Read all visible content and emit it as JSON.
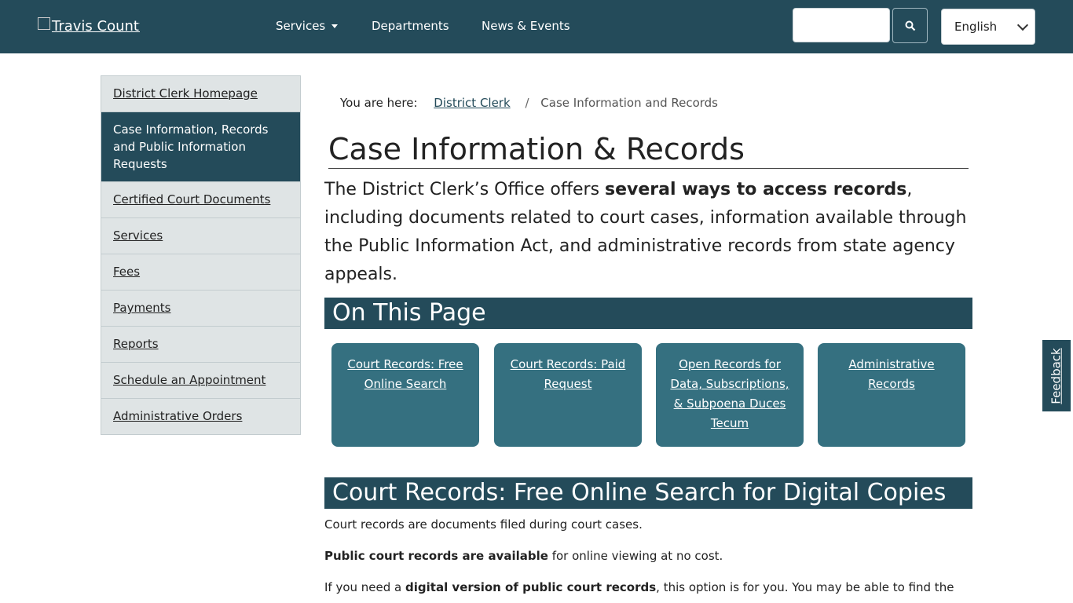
{
  "header": {
    "logo_alt": "Travis County",
    "nav": [
      "Services",
      "Departments",
      "News & Events"
    ],
    "search_placeholder": "",
    "language": "English"
  },
  "sidebar": {
    "items": [
      {
        "label": "District Clerk Homepage",
        "active": false
      },
      {
        "label": "Case Information, Records and Public Information Requests",
        "active": true
      },
      {
        "label": "Certified Court Documents",
        "active": false
      },
      {
        "label": "Services",
        "active": false
      },
      {
        "label": "Fees",
        "active": false
      },
      {
        "label": "Payments",
        "active": false
      },
      {
        "label": "Reports",
        "active": false
      },
      {
        "label": "Schedule an Appointment",
        "active": false
      },
      {
        "label": "Administrative Orders",
        "active": false
      }
    ]
  },
  "breadcrumb": {
    "prefix": "You are here:",
    "parent": "District Clerk",
    "separator": "/",
    "current": "Case Information and Records"
  },
  "main": {
    "title": "Case Information & Records",
    "intro_pre": "The District Clerk’s Office offers ",
    "intro_bold": "several ways to access records",
    "intro_post": ", including documents related to court cases, information available through the Public Information Act, and administrative records from state agency appeals.",
    "on_this_page": "On This Page",
    "cards": [
      "Court Records: Free Online Search",
      "Court Records: Paid Request",
      "Open Records for Data, Subscriptions, & Subpoena Duces Tecum",
      "Administrative Records"
    ],
    "section2_title": "Court Records: Free Online Search for Digital Copies",
    "p1": "Court records are documents filed during court cases.",
    "p2_bold": "Public court records are available",
    "p2_rest": " for online viewing at no cost.",
    "p3_pre": "If you need a ",
    "p3_bold": "digital version of public court records",
    "p3_rest": ", this option is for you. You may be able to find the"
  },
  "feedback": "Feedback",
  "colors": {
    "header": "#244b5a",
    "card": "#357080",
    "sidebar_bg": "#dfe4e5"
  }
}
